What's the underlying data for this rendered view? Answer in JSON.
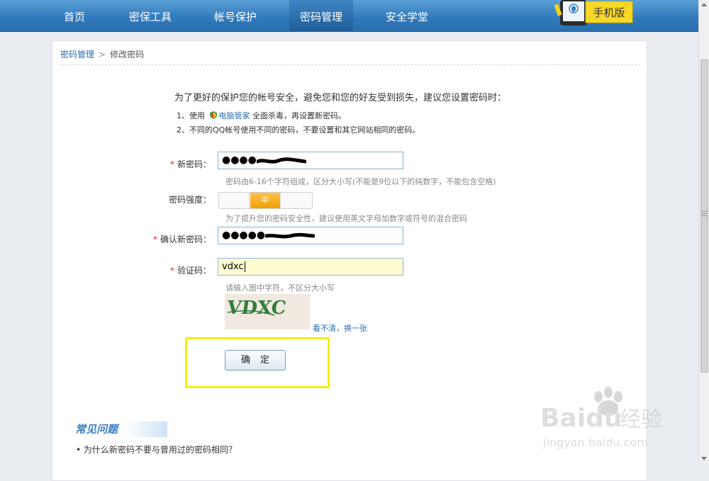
{
  "nav": {
    "items": [
      "首页",
      "密保工具",
      "帐号保护",
      "密码管理",
      "安全学堂"
    ],
    "active_index": 3,
    "mobile_badge": "手机版"
  },
  "breadcrumb": {
    "parent": "密码管理",
    "current": "修改密码",
    "separator": ">"
  },
  "intro": "为了更好的保护您的帐号安全，避免您和您的好友受到损失，建议您设置密码时：",
  "tips": {
    "tip1_before": "1、使用",
    "tip1_link": "电脑管家",
    "tip1_after": "全面杀毒，再设置新密码。",
    "tip2": "2、不同的QQ帐号使用不同的密码，不要设置和其它网站相同的密码。"
  },
  "form": {
    "required_mark": "*",
    "new_password_label": "新密码：",
    "new_password_masked": "●●●●",
    "new_password_hint": "密码由6-16个字符组成，区分大小写(不能是9位以下的纯数字，不能包含空格)",
    "strength_label": "密码强度：",
    "strength_value": "中",
    "strength_hint": "为了提升您的密码安全性，建议使用英文字母加数字或符号的混合密码",
    "confirm_label": "确认新密码：",
    "confirm_masked": "●●●●●",
    "captcha_label": "验证码：",
    "captcha_value": "vdxc",
    "captcha_hint": "请输入图中字符，不区分大小写",
    "captcha_image_text": "VDXC",
    "refresh_link": "看不清，换一张",
    "submit_label": "确定"
  },
  "faq": {
    "title": "常见问题",
    "items": [
      "为什么新密码不要与曾用过的密码相同？"
    ]
  },
  "watermark": {
    "brand": "Baidu",
    "cn": "经验",
    "url": "jingyan.baidu.com"
  },
  "colors": {
    "nav_bg": "#2f78bb",
    "link": "#2b6cb0",
    "required": "#ee2233",
    "highlight": "#f5ee0f",
    "strength_mid": "#f0a000"
  }
}
